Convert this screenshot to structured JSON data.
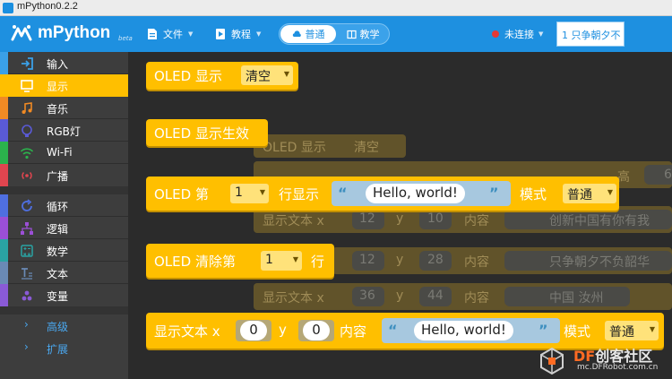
{
  "window": {
    "title": "mPython0.2.2"
  },
  "header": {
    "logo_text": "mPython",
    "logo_badge": "beta",
    "menus": [
      {
        "label": "文件",
        "icon": "file-icon"
      },
      {
        "label": "教程",
        "icon": "tutorial-icon"
      }
    ],
    "modes": [
      {
        "label": "普通",
        "active": true
      },
      {
        "label": "教学",
        "active": false
      }
    ],
    "connection": {
      "label": "未连接",
      "status_color": "#e53935"
    },
    "device": "1 只争朝夕不"
  },
  "sidebar": {
    "categories": [
      {
        "label": "输入",
        "color": "#3aa0e8",
        "icon": "input-icon"
      },
      {
        "label": "显示",
        "color": "#ffbf00",
        "icon": "display-icon",
        "selected": true
      },
      {
        "label": "音乐",
        "color": "#f08a24",
        "icon": "music-icon"
      },
      {
        "label": "RGB灯",
        "color": "#5a5ad6",
        "icon": "rgb-light-icon"
      },
      {
        "label": "Wi-Fi",
        "color": "#2bb24c",
        "icon": "wifi-icon"
      },
      {
        "label": "广播",
        "color": "#e0454f",
        "icon": "broadcast-icon"
      },
      {
        "label": "循环",
        "color": "#4f6fe0",
        "icon": "loop-icon"
      },
      {
        "label": "逻辑",
        "color": "#9b4fd6",
        "icon": "logic-icon"
      },
      {
        "label": "数学",
        "color": "#2aa3a3",
        "icon": "math-icon"
      },
      {
        "label": "文本",
        "color": "#6a8ab5",
        "icon": "text-icon"
      },
      {
        "label": "变量",
        "color": "#8a5ad6",
        "icon": "variable-icon"
      }
    ],
    "extras": [
      {
        "label": "高级"
      },
      {
        "label": "扩展"
      }
    ]
  },
  "blocks": {
    "oled_show": {
      "label": "OLED 显示",
      "option": "清空"
    },
    "oled_apply": {
      "label": "OLED 显示生效"
    },
    "oled_line": {
      "label_a": "OLED 第",
      "line": "1",
      "label_b": "行显示",
      "text": "Hello, world!",
      "mode_label": "模式",
      "mode": "普通"
    },
    "oled_clear_line": {
      "label_a": "OLED 清除第",
      "line": "1",
      "label_b": "行"
    },
    "show_text": {
      "label": "显示文本 x",
      "x": "0",
      "y_label": "y",
      "y": "0",
      "content_label": "内容",
      "text": "Hello, world!",
      "mode_label": "模式",
      "mode": "普通"
    }
  },
  "ghost": {
    "title": "OLED 显示",
    "title_option": "清空",
    "rows": [
      {
        "label": "显示文本 x",
        "x": "12",
        "y_label": "y",
        "y": "10",
        "content_label": "内容",
        "text": "创新中国有你有我"
      },
      {
        "label": "显示文本 x",
        "x": "12",
        "y_label": "y",
        "y": "28",
        "content_label": "内容",
        "text": "只争朝夕不负韶华"
      },
      {
        "label": "显示文本 x",
        "x": "36",
        "y_label": "y",
        "y": "44",
        "content_label": "内容",
        "text": "中国 汝州"
      }
    ],
    "height_label": "高",
    "height_value": "6"
  },
  "watermark": {
    "brand_a": "DF",
    "brand_b": "创客社区",
    "url": "mc.DFRobot.com.cn"
  }
}
